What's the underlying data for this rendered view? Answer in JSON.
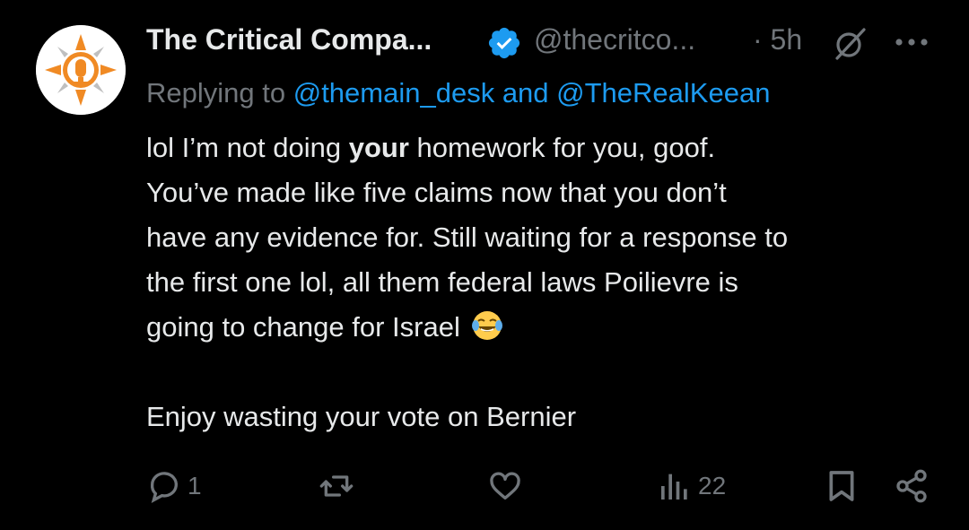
{
  "author": {
    "display_name": "The Critical Compa...",
    "handle": "@thecritco...",
    "time": "· 5h",
    "avatar_icon": "critical-compass-logo",
    "verified_icon": "verified-badge-icon"
  },
  "reply": {
    "prefix": "Replying to ",
    "mention1": "@themain_desk",
    "conjunction": " and ",
    "mention2": "@TheRealKeean"
  },
  "body": {
    "line1_pre": "lol I’m not doing ",
    "line1_bold": "your",
    "line1_post": " homework for you, goof.",
    "line2": "You’ve made like five claims now that you don’t",
    "line3": "have any evidence for. Still waiting for a response to",
    "line4": "the first one lol, all them federal laws Poilievre is",
    "line5": "going to change for Israel",
    "line5_emoji": "face-with-tears-of-joy",
    "line7": "Enjoy wasting your vote on Bernier"
  },
  "actions": {
    "reply_count": "1",
    "retweet_count": "",
    "like_count": "",
    "views_count": "22"
  },
  "colors": {
    "background": "#000000",
    "text": "#e7e9ea",
    "muted": "#71767b",
    "accent": "#1d9bf0",
    "logo_orange": "#f08a24"
  }
}
